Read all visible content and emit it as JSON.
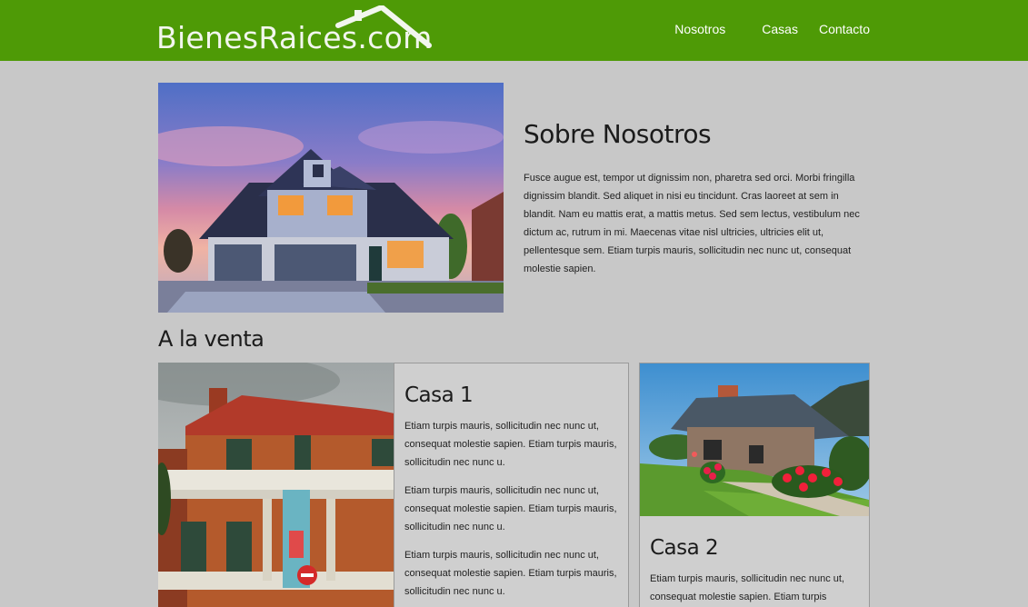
{
  "brand": {
    "logo_text": "BienesRaices.com"
  },
  "nav": {
    "items": [
      "Nosotros",
      "Casas",
      "Contacto"
    ]
  },
  "about": {
    "title": "Sobre Nosotros",
    "text": "Fusce augue est, tempor ut dignissim non, pharetra sed orci. Morbi fringilla dignissim blandit. Sed aliquet in nisi eu tincidunt. Cras laoreet at sem in blandit. Nam eu mattis erat, a mattis metus. Sed sem lectus, vestibulum nec dictum ac, rutrum in mi. Maecenas vitae nisl ultricies, ultricies elit ut, pellentesque sem. Etiam turpis mauris, sollicitudin nec nunc ut, consequat molestie sapien."
  },
  "sale": {
    "title": "A la venta",
    "cards": [
      {
        "title": "Casa 1",
        "paragraphs": [
          "Etiam turpis mauris, sollicitudin nec nunc ut, consequat molestie sapien. Etiam turpis mauris, sollicitudin nec nunc u.",
          "Etiam turpis mauris, sollicitudin nec nunc ut, consequat molestie sapien. Etiam turpis mauris, sollicitudin nec nunc u.",
          "Etiam turpis mauris, sollicitudin nec nunc ut, consequat molestie sapien. Etiam turpis mauris, sollicitudin nec nunc u."
        ]
      },
      {
        "title": "Casa 2",
        "paragraphs": [
          "Etiam turpis mauris, sollicitudin nec nunc ut, consequat molestie sapien. Etiam turpis"
        ]
      }
    ]
  },
  "colors": {
    "header_green": "#4e9a06",
    "page_bg": "#c8c8c8",
    "card_bg": "#cfcfcf"
  }
}
